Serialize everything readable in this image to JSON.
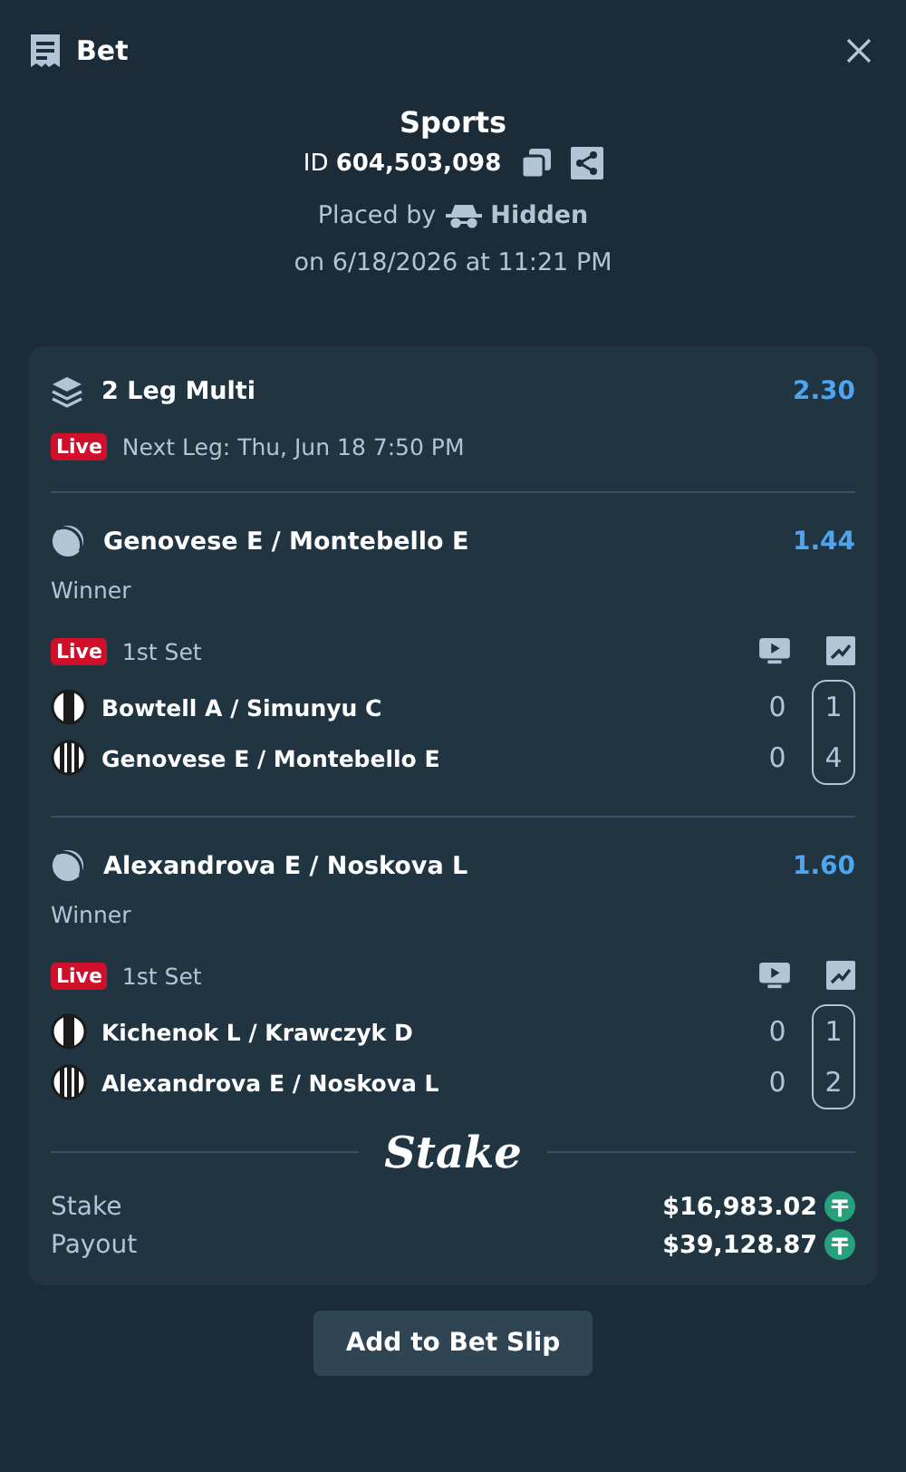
{
  "header": {
    "title": "Bet"
  },
  "summary": {
    "category": "Sports",
    "id_label": "ID",
    "id": "604,503,098",
    "placed_by_label": "Placed by",
    "user": "Hidden",
    "placed_on": "on 6/18/2026 at 11:21 PM"
  },
  "multi": {
    "title": "2 Leg Multi",
    "odds": "2.30",
    "live_badge": "Live",
    "next_leg": "Next Leg: Thu, Jun 18 7:50 PM"
  },
  "legs": [
    {
      "match": "Genovese E / Montebello E",
      "odds": "1.44",
      "market": "Winner",
      "live_badge": "Live",
      "period": "1st Set",
      "teams": [
        {
          "name": "Bowtell A / Simunyu C",
          "kind": "wide",
          "score": "0",
          "set_score": "1"
        },
        {
          "name": "Genovese E / Montebello E",
          "kind": "striped",
          "score": "0",
          "set_score": "4"
        }
      ]
    },
    {
      "match": "Alexandrova E / Noskova L",
      "odds": "1.60",
      "market": "Winner",
      "live_badge": "Live",
      "period": "1st Set",
      "teams": [
        {
          "name": "Kichenok L / Krawczyk D",
          "kind": "wide",
          "score": "0",
          "set_score": "1"
        },
        {
          "name": "Alexandrova E / Noskova L",
          "kind": "striped",
          "score": "0",
          "set_score": "2"
        }
      ]
    }
  ],
  "brand": "Stake",
  "totals": [
    {
      "label": "Stake",
      "amount": "$16,983.02"
    },
    {
      "label": "Payout",
      "amount": "$39,128.87"
    }
  ],
  "action_button": "Add to Bet Slip"
}
